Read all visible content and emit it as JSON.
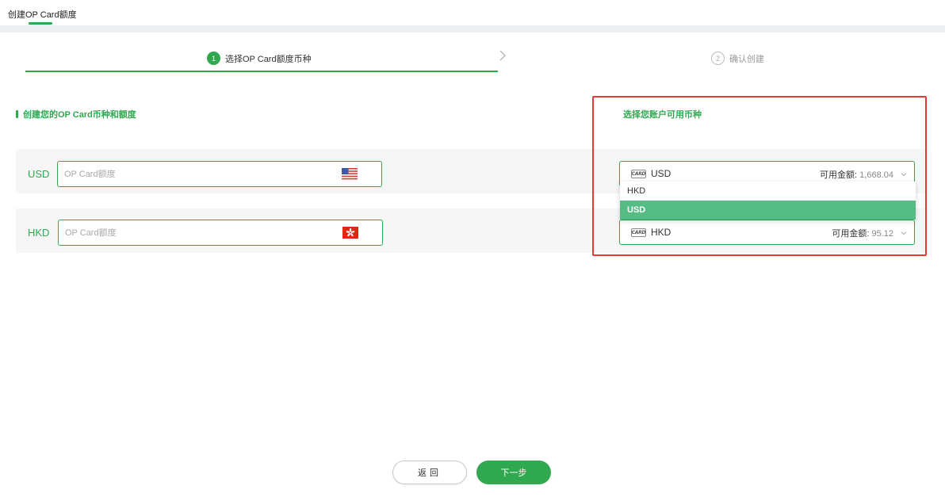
{
  "header": {
    "tab_label": "创建OP Card额度"
  },
  "steps": [
    {
      "number": "1",
      "label": "选择OP Card额度币种",
      "state": "active"
    },
    {
      "number": "2",
      "label": "确认创建",
      "state": "inactive"
    }
  ],
  "left_section": {
    "title": "创建您的OP Card币种和额度",
    "rows": [
      {
        "currency": "USD",
        "placeholder": "OP Card额度",
        "flag_icon": "us-flag-icon"
      },
      {
        "currency": "HKD",
        "placeholder": "OP Card额度",
        "flag_icon": "hk-flag-icon"
      }
    ]
  },
  "right_section": {
    "title": "选择您账户可用币种",
    "card_icon_text": "CARD",
    "selects": [
      {
        "currency": "USD",
        "balance_label": "可用金额:",
        "balance": "1,668.04"
      },
      {
        "currency": "HKD",
        "balance_label": "可用金额:",
        "balance": "95.12"
      }
    ],
    "dropdown_options": [
      "HKD",
      "USD"
    ],
    "dropdown_selected": "USD"
  },
  "buttons": {
    "back": "返回",
    "next": "下一步"
  },
  "colors": {
    "accent": "#2fa84f",
    "dropdown_selected_bg": "#56bc86",
    "highlight_box": "#e53935"
  }
}
